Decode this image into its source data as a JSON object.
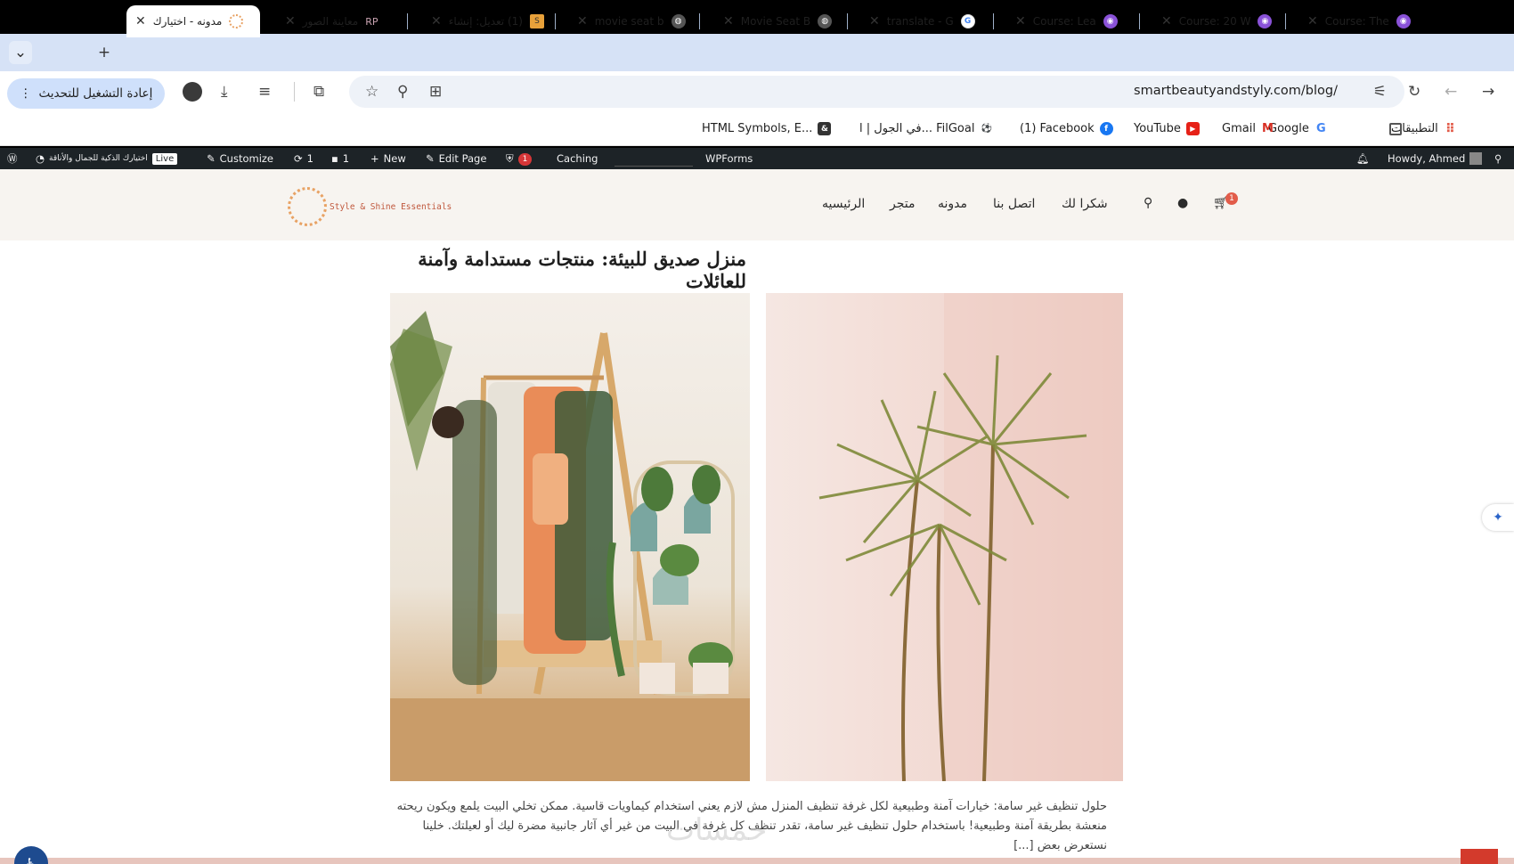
{
  "browser": {
    "tabs": [
      {
        "title": "مدونه - اختيارك",
        "icon": "loading-spinner-icon",
        "active": true
      },
      {
        "title": "معاينة الصور",
        "icon": "rp-icon"
      },
      {
        "title": "(1) تعديل: إنشاء",
        "icon": "orange-s-icon"
      },
      {
        "title": "movie seat b",
        "icon": "globe-icon"
      },
      {
        "title": "Movie Seat B",
        "icon": "globe-icon"
      },
      {
        "title": "translate - G",
        "icon": "google-icon"
      },
      {
        "title": "Course: Lea",
        "icon": "course-icon"
      },
      {
        "title": "Course: 20 W",
        "icon": "course-icon"
      },
      {
        "title": "Course: The",
        "icon": "course-icon"
      }
    ],
    "url": "smartbeautyandstyly.com/blog/",
    "restart_label": "إعادة التشغيل للتحديث",
    "bookmarks": [
      {
        "label": "التطبيقات",
        "icon": "apps-grid-icon"
      },
      {
        "label": "Google",
        "icon": "google-icon"
      },
      {
        "label": "Gmail",
        "icon": "gmail-icon"
      },
      {
        "label": "YouTube",
        "icon": "youtube-icon"
      },
      {
        "label": "(1) Facebook",
        "icon": "facebook-icon"
      },
      {
        "label": "في الجول | ا... FilGoal",
        "icon": "filgoal-icon"
      },
      {
        "label": "HTML Symbols, E...",
        "icon": "html-symbols-icon"
      }
    ]
  },
  "adminbar": {
    "site_name": "اختيارك الذكية للجمال والأناقة",
    "live": "Live",
    "customize": "Customize",
    "updates_count": "1",
    "comments_count": "1",
    "new": "New",
    "edit_page": "Edit Page",
    "plugin_badge": "1",
    "caching": "Caching",
    "wpforms": "WPForms",
    "howdy": "Howdy, Ahmed"
  },
  "site": {
    "logo_text": "Style & Shine Essentials",
    "nav": [
      "الرئيسيه",
      "متجر",
      "مدونه",
      "اتصل بنا",
      "شكرا لك"
    ],
    "cart_count": "1",
    "post_title": "منزل صديق للبيئة: منتجات مستدامة وآمنة للعائلات",
    "excerpt": "حلول تنظيف غير سامة: خيارات آمنة وطبيعية لكل غرفة تنظيف المنزل مش لازم يعني استخدام كيماويات قاسية. ممكن تخلي البيت يلمع ويكون ريحته منعشة بطريقة آمنة وطبيعية! باستخدام حلول تنظيف غير سامة، تقدر تنظف كل غرفة في البيت من غير أي آثار جانبية مضرة ليك أو لعيلتك. خلينا نستعرض بعض [...]",
    "watermark": "خمسات"
  },
  "colors": {
    "tabstrip": "#d6e2f6",
    "adminbar": "#1d2327",
    "header_bg": "#f7f4f0",
    "accent": "#e25c4a"
  }
}
